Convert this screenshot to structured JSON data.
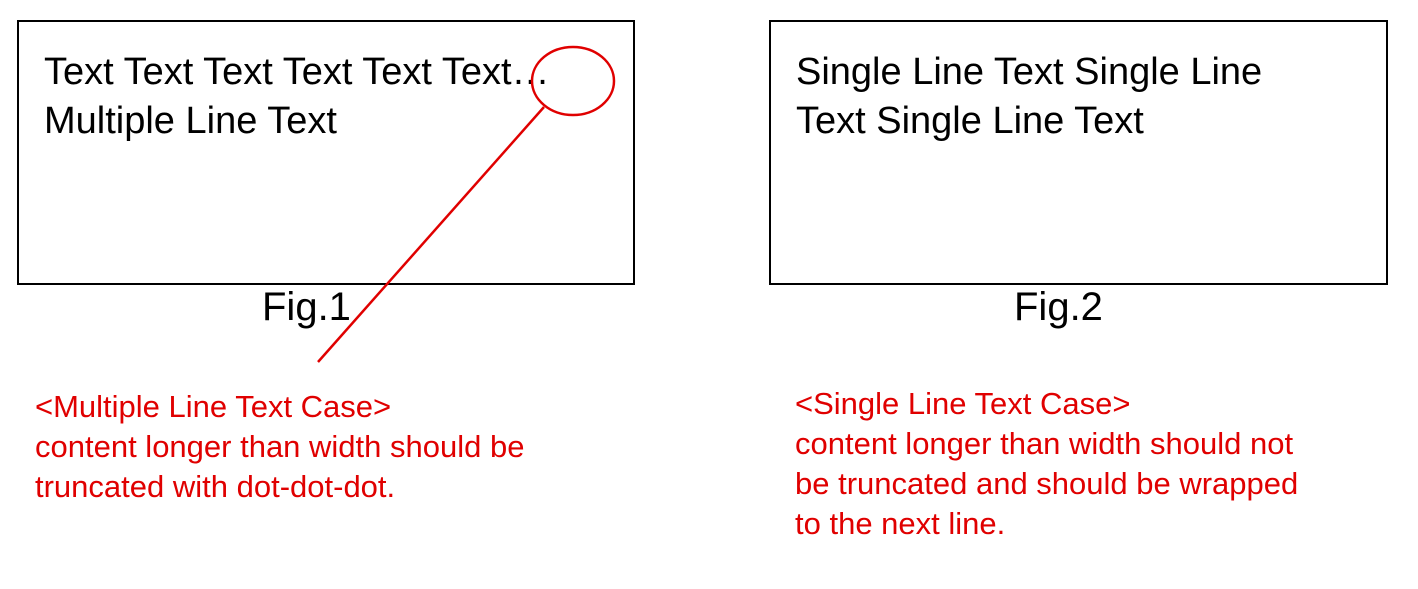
{
  "figure1": {
    "line1": "Text Text Text Text Text Text…",
    "line2": "Multiple Line Text",
    "caption": "Fig.1",
    "note": {
      "heading": "<Multiple Line Text Case>",
      "lines": [
        "content longer than width should be",
        "truncated with dot-dot-dot."
      ]
    }
  },
  "figure2": {
    "line1": "Single Line Text Single Line",
    "line2": "Text Single Line Text",
    "caption": "Fig.2",
    "note": {
      "heading": "<Single Line Text Case>",
      "lines": [
        "content longer than width should not",
        "be truncated and should be wrapped",
        "to the next line."
      ]
    }
  },
  "colors": {
    "annotation": "#e00000",
    "text": "#000000",
    "border": "#000000"
  }
}
